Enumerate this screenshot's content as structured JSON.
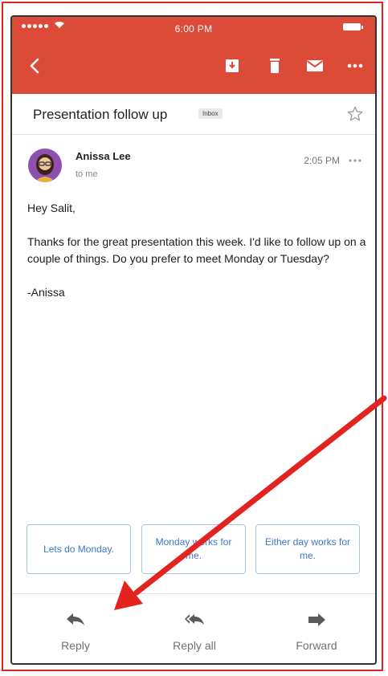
{
  "status_bar": {
    "time": "6:00 PM"
  },
  "toolbar": {
    "back_icon": "chevron-left-icon",
    "actions": [
      "archive-icon",
      "trash-icon",
      "mail-icon",
      "more-horizontal-icon"
    ]
  },
  "email": {
    "subject": "Presentation follow up",
    "label": "Inbox",
    "sender": {
      "name": "Anissa Lee",
      "recipient": "to me",
      "time": "2:05 PM"
    },
    "greeting": "Hey Salit,",
    "paragraphs": [
      "Thanks for the great presentation this week. I'd like to follow up on a couple of things. Do you prefer to meet Monday or Tuesday?"
    ],
    "signature": "-Anissa"
  },
  "smart_replies": [
    "Lets do Monday.",
    "Monday works for me.",
    "Either day works for me."
  ],
  "bottom_actions": {
    "reply": "Reply",
    "reply_all": "Reply all",
    "forward": "Forward"
  },
  "colors": {
    "header": "#dc4a38",
    "annotation_red": "#e3231f",
    "chip_text": "#3b79c6",
    "chip_border": "#a9c3e3",
    "avatar_bg": "#8e4fb0"
  }
}
